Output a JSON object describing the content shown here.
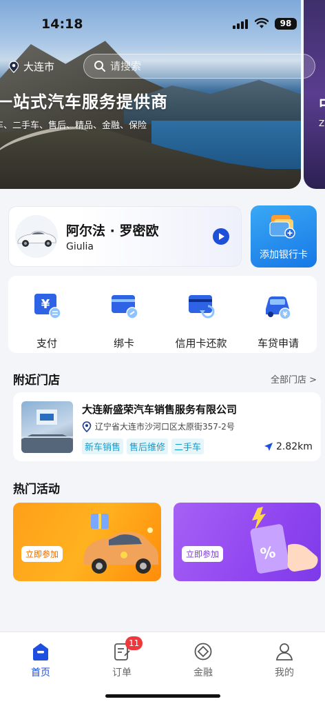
{
  "status_bar": {
    "time": "14:18",
    "battery": "98"
  },
  "header": {
    "city": "大连市",
    "search_placeholder": "请搜索",
    "banner_title": "一站式汽车服务提供商",
    "banner_subtitle": "车、二手车、售后、精品、金融、保险",
    "banner_peek_title": "中",
    "banner_peek_sub": "Z"
  },
  "car": {
    "name": "阿尔法 · 罗密欧",
    "model": "Giulia"
  },
  "bank_card": {
    "label": "添加银行卡"
  },
  "services": [
    {
      "label": "支付",
      "icon": "pay-icon"
    },
    {
      "label": "绑卡",
      "icon": "bind-card-icon"
    },
    {
      "label": "信用卡还款",
      "icon": "credit-repay-icon"
    },
    {
      "label": "车贷申请",
      "icon": "car-loan-icon"
    }
  ],
  "nearby": {
    "title": "附近门店",
    "all_link": "全部门店 >",
    "store": {
      "name": "大连新盛荣汽车销售服务有限公司",
      "address": "辽宁省大连市沙河口区太原街357-2号",
      "tags": [
        "新车销售",
        "售后维修",
        "二手车"
      ],
      "distance": "2.82km"
    }
  },
  "promotions": {
    "title": "热门活动",
    "items": [
      {
        "button": "立即参加"
      },
      {
        "button": "立即参加"
      }
    ]
  },
  "tabbar": {
    "tabs": [
      {
        "label": "首页",
        "icon": "home-icon",
        "active": true
      },
      {
        "label": "订单",
        "icon": "orders-icon",
        "badge": "11"
      },
      {
        "label": "金融",
        "icon": "finance-icon"
      },
      {
        "label": "我的",
        "icon": "profile-icon"
      }
    ]
  },
  "colors": {
    "accent": "#1f4fe0",
    "tag_text": "#169ac8",
    "badge": "#f0383c"
  }
}
